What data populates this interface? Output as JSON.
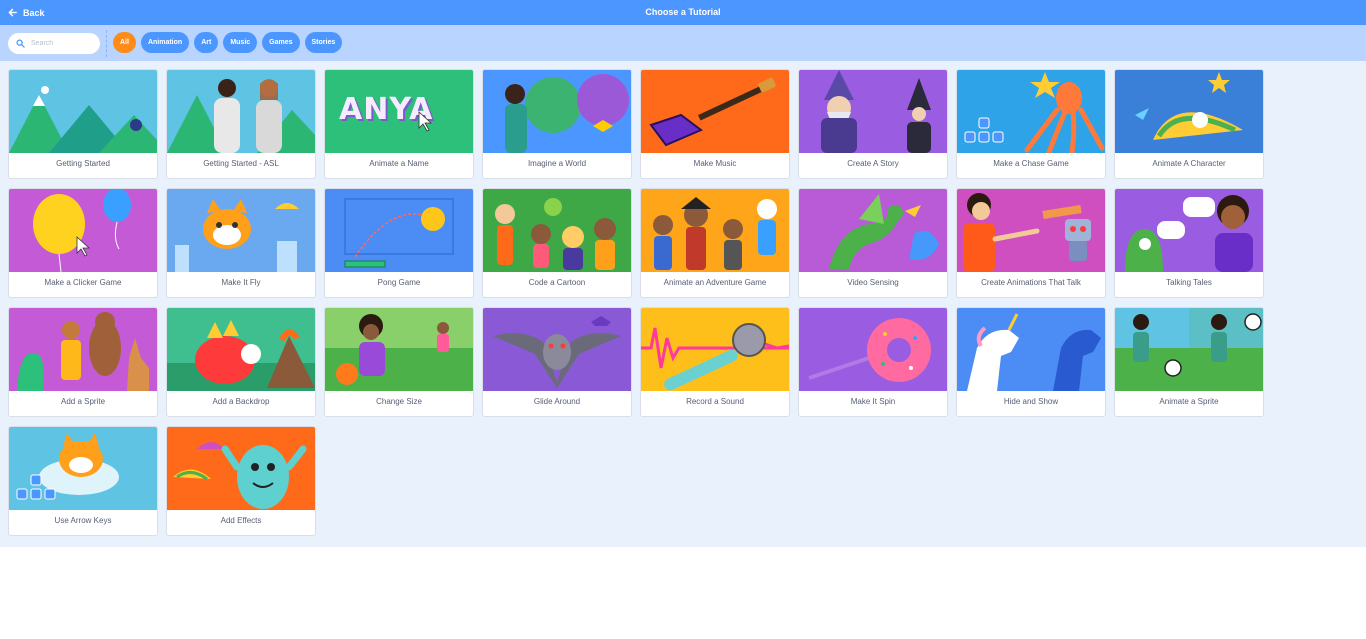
{
  "header": {
    "back_label": "Back",
    "title": "Choose a Tutorial"
  },
  "search": {
    "placeholder": "Search",
    "value": ""
  },
  "tags": [
    "All",
    "Animation",
    "Art",
    "Music",
    "Games",
    "Stories"
  ],
  "active_tag": "All",
  "colors": {
    "header": "#4c97ff",
    "filterbar": "#b8d4ff",
    "library": "#e9f1fc",
    "active_tag": "#ff8c1a",
    "tag": "#4c97ff"
  },
  "tutorials": [
    {
      "label": "Getting Started",
      "theme": "#5fc3e4"
    },
    {
      "label": "Getting Started - ASL",
      "theme": "#5fc3e4"
    },
    {
      "label": "Animate a Name",
      "theme": "#2cc07a"
    },
    {
      "label": "Imagine a World",
      "theme": "#8b5ad8"
    },
    {
      "label": "Make Music",
      "theme": "#ff6a1a"
    },
    {
      "label": "Create A Story",
      "theme": "#9a5ce0"
    },
    {
      "label": "Make a Chase Game",
      "theme": "#2fa3e8"
    },
    {
      "label": "Animate A Character",
      "theme": "#3a7fd8"
    },
    {
      "label": "Make a Clicker Game",
      "theme": "#c45ad6"
    },
    {
      "label": "Make It Fly",
      "theme": "#6aa8f0"
    },
    {
      "label": "Pong Game",
      "theme": "#4c8cf5"
    },
    {
      "label": "Code a Cartoon",
      "theme": "#3fa846"
    },
    {
      "label": "Animate an Adventure Game",
      "theme": "#ffa51a"
    },
    {
      "label": "Video Sensing",
      "theme": "#b95ad6"
    },
    {
      "label": "Create Animations That Talk",
      "theme": "#d04fc0"
    },
    {
      "label": "Talking Tales",
      "theme": "#9a5ce0"
    },
    {
      "label": "Add a Sprite",
      "theme": "#c45ad6"
    },
    {
      "label": "Add a Backdrop",
      "theme": "#3fbf8f"
    },
    {
      "label": "Change Size",
      "theme": "#4db14a"
    },
    {
      "label": "Glide Around",
      "theme": "#8a5ad6"
    },
    {
      "label": "Record a Sound",
      "theme": "#ffbf1a"
    },
    {
      "label": "Make It Spin",
      "theme": "#9a5ce0"
    },
    {
      "label": "Hide and Show",
      "theme": "#4c8cf5"
    },
    {
      "label": "Animate a Sprite",
      "theme": "#4db14a"
    },
    {
      "label": "Use Arrow Keys",
      "theme": "#5fc3e4"
    },
    {
      "label": "Add Effects",
      "theme": "#ff6a1a"
    }
  ],
  "thumb_text": {
    "animate_name": "ANYA"
  }
}
